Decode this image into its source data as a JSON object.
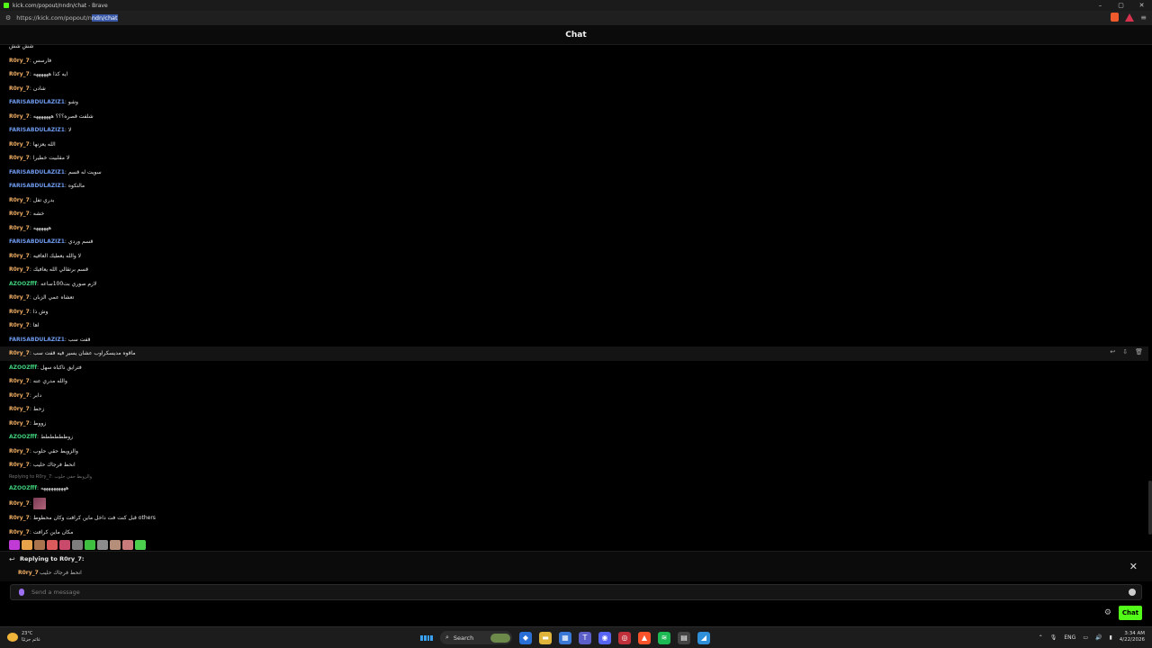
{
  "window": {
    "title": "kick.com/popout/nndn/chat - Brave",
    "controls": [
      "–",
      "▢",
      "✕"
    ]
  },
  "address": {
    "url_prefix": "https://kick.com/popout/n",
    "url_selected": "ndn/chat"
  },
  "chat": {
    "header": "Chat",
    "messages": [
      {
        "user": "",
        "text": "شش شش",
        "color": "orange"
      },
      {
        "user": "R0ry_7",
        "text": "فارسس",
        "color": "orange"
      },
      {
        "user": "R0ry_7",
        "text": "ايه كذا ههههههه",
        "color": "orange"
      },
      {
        "user": "R0ry_7",
        "text": "شادن",
        "color": "orange"
      },
      {
        "user": "FARISABDULAZIZ1",
        "text": "وشو",
        "color": "blue"
      },
      {
        "user": "R0ry_7",
        "text": "شلفت قصره؟؟؟ هههههههه",
        "color": "orange"
      },
      {
        "user": "FARISABDULAZIZ1",
        "text": "لا",
        "color": "blue"
      },
      {
        "user": "R0ry_7",
        "text": "الله يعزنها",
        "color": "orange"
      },
      {
        "user": "R0ry_7",
        "text": "لا مقلبيت خطيرا",
        "color": "orange"
      },
      {
        "user": "FARISABDULAZIZ1",
        "text": "سويت له قسم",
        "color": "blue"
      },
      {
        "user": "FARISABDULAZIZ1",
        "text": "مالتكوه",
        "color": "blue"
      },
      {
        "user": "R0ry_7",
        "text": "بدري تفل",
        "color": "orange"
      },
      {
        "user": "R0ry_7",
        "text": "خشه",
        "color": "orange"
      },
      {
        "user": "R0ry_7",
        "text": "ههههههه",
        "color": "orange"
      },
      {
        "user": "FARISABDULAZIZ1",
        "text": "قسم وردي",
        "color": "blue"
      },
      {
        "user": "R0ry_7",
        "text": "لا والله يعطيك العافيه",
        "color": "orange"
      },
      {
        "user": "R0ry_7",
        "text": "قسم برتقالي الله يعافيك",
        "color": "orange"
      },
      {
        "user": "AZOOZfff",
        "text": "لازم صوري بت100ساعه",
        "color": "green"
      },
      {
        "user": "R0ry_7",
        "text": "تعشاه عمي الزبان",
        "color": "orange"
      },
      {
        "user": "R0ry_7",
        "text": "وش ذا",
        "color": "orange"
      },
      {
        "user": "R0ry_7",
        "text": "اها",
        "color": "orange"
      },
      {
        "user": "FARISABDULAZIZ1",
        "text": "قفت سب",
        "color": "blue"
      },
      {
        "user": "R0ry_7",
        "text": "ماقوه مديسكراوب عشان يسير فيه قفت سب",
        "color": "orange",
        "highlight": true
      },
      {
        "user": "AZOOZfff",
        "text": "فترايق ناكباه سهل",
        "color": "green"
      },
      {
        "user": "R0ry_7",
        "text": "والله مدري عنه",
        "color": "orange"
      },
      {
        "user": "R0ry_7",
        "text": "دابر",
        "color": "orange"
      },
      {
        "user": "R0ry_7",
        "text": "زحط",
        "color": "orange"
      },
      {
        "user": "R0ry_7",
        "text": "زووط",
        "color": "orange"
      },
      {
        "user": "AZOOZfff",
        "text": "زوطططططط",
        "color": "green"
      },
      {
        "user": "R0ry_7",
        "text": "والزويط حقي حلوب",
        "color": "orange"
      },
      {
        "user": "R0ry_7",
        "text": "انحط فرجاك حليب",
        "color": "orange"
      }
    ],
    "reply_hint": "Replying to R0ry_7: والزويط حقي حلوب",
    "messages_after": [
      {
        "user": "AZOOZfff",
        "text": "ههههههههههه",
        "color": "green"
      },
      {
        "user": "R0ry_7",
        "text": "",
        "color": "orange",
        "image": true
      },
      {
        "user": "R0ry_7",
        "text": "قبل كنت فت داخل ماين كرافت وكان محطوط others",
        "color": "orange"
      },
      {
        "user": "R0ry_7",
        "text": "مكان ماين كرافت",
        "color": "orange"
      }
    ],
    "emote_colors": [
      "#c03ad6",
      "#e8a24a",
      "#a9734e",
      "#d95b5b",
      "#c94a6a",
      "#7d7d7d",
      "#3fbf3f",
      "#8c8c8c",
      "#b58f7a",
      "#c97a7a",
      "#4ccf4c"
    ],
    "reply": {
      "title": "Replying to R0ry_7:",
      "user": "R0ry_7",
      "text": "انحط فرجاك حليب",
      "close": "✕"
    },
    "input": {
      "placeholder": "Send a message"
    },
    "chat_button": "Chat"
  },
  "taskbar": {
    "weather_temp": "23°C",
    "weather_desc": "غائم جزئيًا",
    "search": "Search",
    "lang": "ENG",
    "time": "3:34 AM",
    "date": "4/22/2026"
  },
  "colors": {
    "orange": "#f4b165",
    "blue": "#6f9bf0",
    "green": "#3fcf7a",
    "kick_green": "#53fc18"
  }
}
